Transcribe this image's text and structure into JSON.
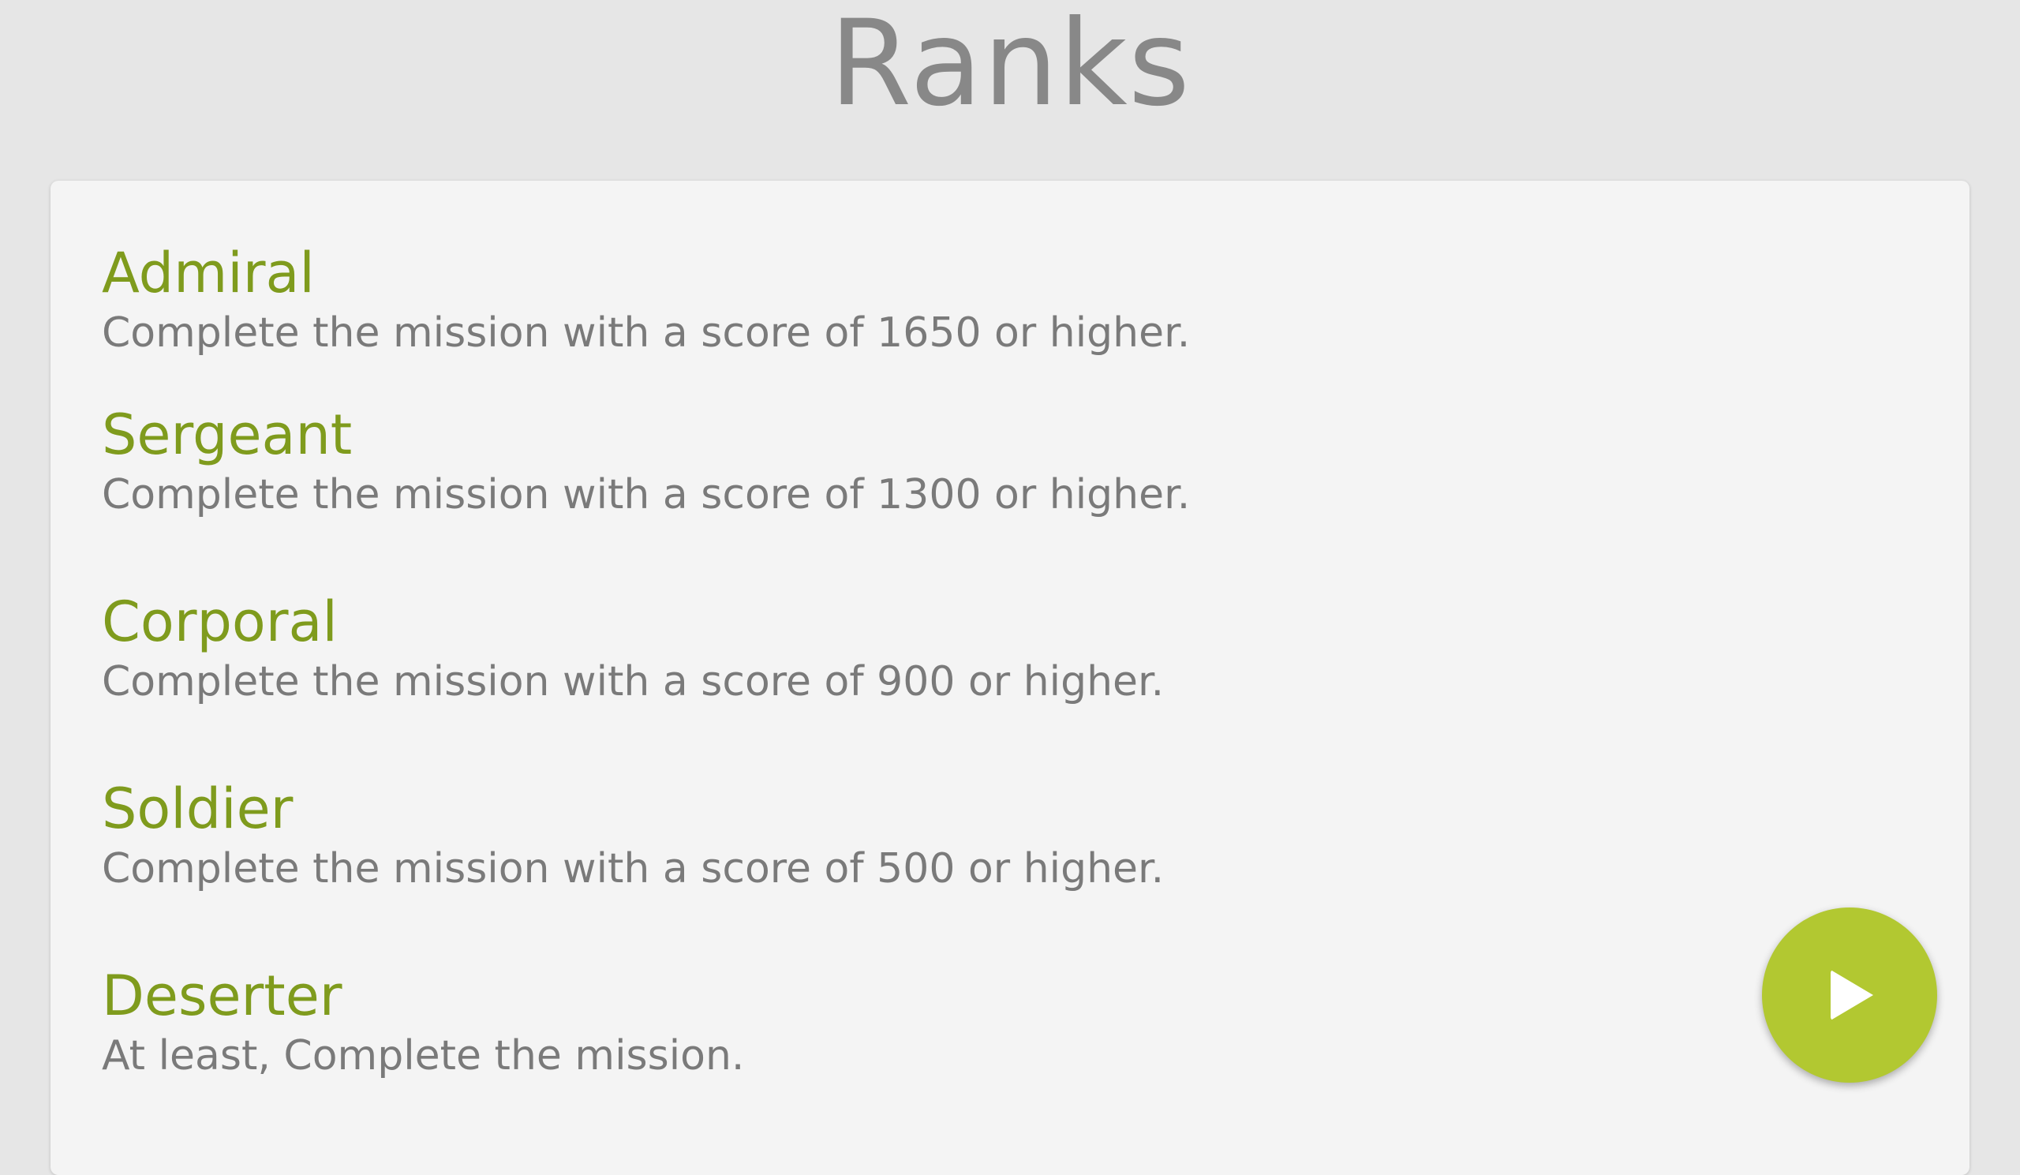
{
  "page": {
    "title": "Ranks"
  },
  "ranks": [
    {
      "name": "Admiral",
      "description": "Complete the mission with a score of 1650 or higher."
    },
    {
      "name": "Sergeant",
      "description": "Complete the mission with a score of 1300 or higher."
    },
    {
      "name": "Corporal",
      "description": "Complete the mission with a score of 900 or higher."
    },
    {
      "name": "Soldier",
      "description": "Complete the mission with a score of 500 or higher."
    },
    {
      "name": "Deserter",
      "description": "At least, Complete the mission."
    }
  ],
  "play_button": {
    "icon": "play-icon",
    "color": "#b2c831"
  },
  "colors": {
    "background": "#e6e6e6",
    "card": "#f4f4f4",
    "rank_name": "#7f9b1d",
    "description": "#7a7a7a",
    "title": "#888888"
  }
}
